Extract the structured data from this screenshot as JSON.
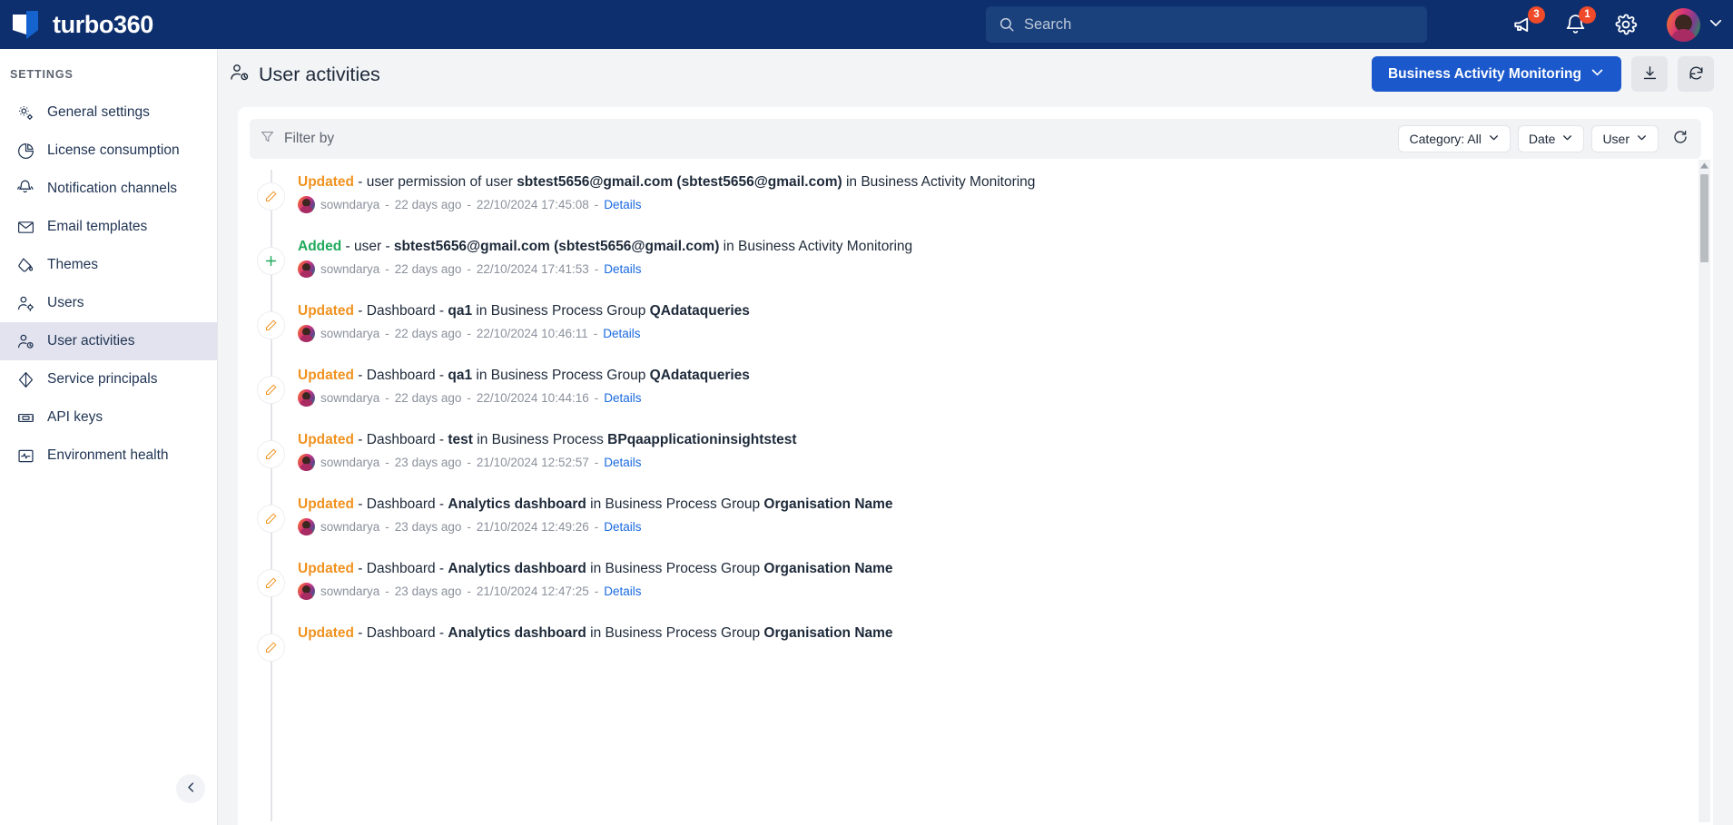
{
  "topbar": {
    "brand_name": "turbo360",
    "logo_icon": "turbo360-logo-icon",
    "search": {
      "placeholder": "Search",
      "value": "",
      "icon": "search-icon"
    },
    "announcements": {
      "icon": "megaphone-icon",
      "badge": "3"
    },
    "notifications": {
      "icon": "bell-icon",
      "badge": "1"
    },
    "settings": {
      "icon": "gear-icon"
    },
    "avatar": {
      "icon": "avatar",
      "chevron": "chevron-down-icon"
    },
    "bg_color": "#0d2f6e"
  },
  "sidebar": {
    "section_label": "SETTINGS",
    "items": [
      {
        "label": "General settings",
        "icon": "gears-icon",
        "active": false
      },
      {
        "label": "License consumption",
        "icon": "pie-chart-icon",
        "active": false
      },
      {
        "label": "Notification channels",
        "icon": "bells-icon",
        "active": false
      },
      {
        "label": "Email templates",
        "icon": "envelope-icon",
        "active": false
      },
      {
        "label": "Themes",
        "icon": "paint-bucket-icon",
        "active": false
      },
      {
        "label": "Users",
        "icon": "user-gear-icon",
        "active": false
      },
      {
        "label": "User activities",
        "icon": "user-clock-icon",
        "active": true
      },
      {
        "label": "Service principals",
        "icon": "diamond-icon",
        "active": false
      },
      {
        "label": "API keys",
        "icon": "key-card-icon",
        "active": false
      },
      {
        "label": "Environment health",
        "icon": "heart-monitor-icon",
        "active": false
      }
    ],
    "collapse_button": {
      "icon": "chevron-left-icon"
    }
  },
  "header": {
    "title": "User activities",
    "title_icon": "user-clock-icon",
    "primary_button": {
      "label": "Business Activity Monitoring",
      "icon": "chevron-down-icon",
      "color": "#1a58cc"
    },
    "download_button": {
      "icon": "download-icon"
    },
    "refresh_button": {
      "icon": "refresh-icon"
    }
  },
  "filter_bar": {
    "filter_by_label": "Filter by",
    "filter_icon": "funnel-icon",
    "pills": [
      {
        "label": "Category: All",
        "icon": "chevron-down-icon"
      },
      {
        "label": "Date",
        "icon": "chevron-down-icon"
      },
      {
        "label": "User",
        "icon": "chevron-down-icon"
      }
    ],
    "refresh": {
      "icon": "refresh-icon"
    }
  },
  "activities": [
    {
      "icon": "pencil-icon",
      "verb": "Updated",
      "verb_type": "updated",
      "parts": [
        {
          "text": " - user permission of user ",
          "bold": false
        },
        {
          "text": "sbtest5656@gmail.com (sbtest5656@gmail.com)",
          "bold": true
        },
        {
          "text": " in Business Activity Monitoring",
          "bold": false
        }
      ],
      "user": "sowndarya",
      "relative_time": "22 days ago",
      "timestamp": "22/10/2024 17:45:08",
      "details_label": "Details"
    },
    {
      "icon": "plus-icon",
      "verb": "Added",
      "verb_type": "added",
      "parts": [
        {
          "text": " - user - ",
          "bold": false
        },
        {
          "text": "sbtest5656@gmail.com (sbtest5656@gmail.com)",
          "bold": true
        },
        {
          "text": " in Business Activity Monitoring",
          "bold": false
        }
      ],
      "user": "sowndarya",
      "relative_time": "22 days ago",
      "timestamp": "22/10/2024 17:41:53",
      "details_label": "Details"
    },
    {
      "icon": "pencil-icon",
      "verb": "Updated",
      "verb_type": "updated",
      "parts": [
        {
          "text": " - Dashboard - ",
          "bold": false
        },
        {
          "text": "qa1",
          "bold": true
        },
        {
          "text": " in Business Process Group ",
          "bold": false
        },
        {
          "text": "QAdataqueries",
          "bold": true
        }
      ],
      "user": "sowndarya",
      "relative_time": "22 days ago",
      "timestamp": "22/10/2024 10:46:11",
      "details_label": "Details"
    },
    {
      "icon": "pencil-icon",
      "verb": "Updated",
      "verb_type": "updated",
      "parts": [
        {
          "text": " - Dashboard - ",
          "bold": false
        },
        {
          "text": "qa1",
          "bold": true
        },
        {
          "text": " in Business Process Group ",
          "bold": false
        },
        {
          "text": "QAdataqueries",
          "bold": true
        }
      ],
      "user": "sowndarya",
      "relative_time": "22 days ago",
      "timestamp": "22/10/2024 10:44:16",
      "details_label": "Details"
    },
    {
      "icon": "pencil-icon",
      "verb": "Updated",
      "verb_type": "updated",
      "parts": [
        {
          "text": " - Dashboard - ",
          "bold": false
        },
        {
          "text": "test",
          "bold": true
        },
        {
          "text": " in Business Process ",
          "bold": false
        },
        {
          "text": "BPqaapplicationinsightstest",
          "bold": true
        }
      ],
      "user": "sowndarya",
      "relative_time": "23 days ago",
      "timestamp": "21/10/2024 12:52:57",
      "details_label": "Details"
    },
    {
      "icon": "pencil-icon",
      "verb": "Updated",
      "verb_type": "updated",
      "parts": [
        {
          "text": " - Dashboard - ",
          "bold": false
        },
        {
          "text": "Analytics dashboard",
          "bold": true
        },
        {
          "text": " in Business Process Group ",
          "bold": false
        },
        {
          "text": "Organisation Name",
          "bold": true
        }
      ],
      "user": "sowndarya",
      "relative_time": "23 days ago",
      "timestamp": "21/10/2024 12:49:26",
      "details_label": "Details"
    },
    {
      "icon": "pencil-icon",
      "verb": "Updated",
      "verb_type": "updated",
      "parts": [
        {
          "text": " - Dashboard - ",
          "bold": false
        },
        {
          "text": "Analytics dashboard",
          "bold": true
        },
        {
          "text": " in Business Process Group ",
          "bold": false
        },
        {
          "text": "Organisation Name",
          "bold": true
        }
      ],
      "user": "sowndarya",
      "relative_time": "23 days ago",
      "timestamp": "21/10/2024 12:47:25",
      "details_label": "Details"
    },
    {
      "icon": "pencil-icon",
      "verb": "Updated",
      "verb_type": "updated",
      "parts": [
        {
          "text": " - Dashboard - ",
          "bold": false
        },
        {
          "text": "Analytics dashboard",
          "bold": true
        },
        {
          "text": " in Business Process Group ",
          "bold": false
        },
        {
          "text": "Organisation Name",
          "bold": true
        }
      ],
      "user": "",
      "relative_time": "",
      "timestamp": "",
      "details_label": ""
    }
  ],
  "colors": {
    "navy": "#0d2f6e",
    "accent_blue": "#1a58cc",
    "updated_orange": "#f0921f",
    "added_green": "#1fa95c",
    "link_blue": "#1a6ae0",
    "badge_red": "#f04a2a"
  }
}
